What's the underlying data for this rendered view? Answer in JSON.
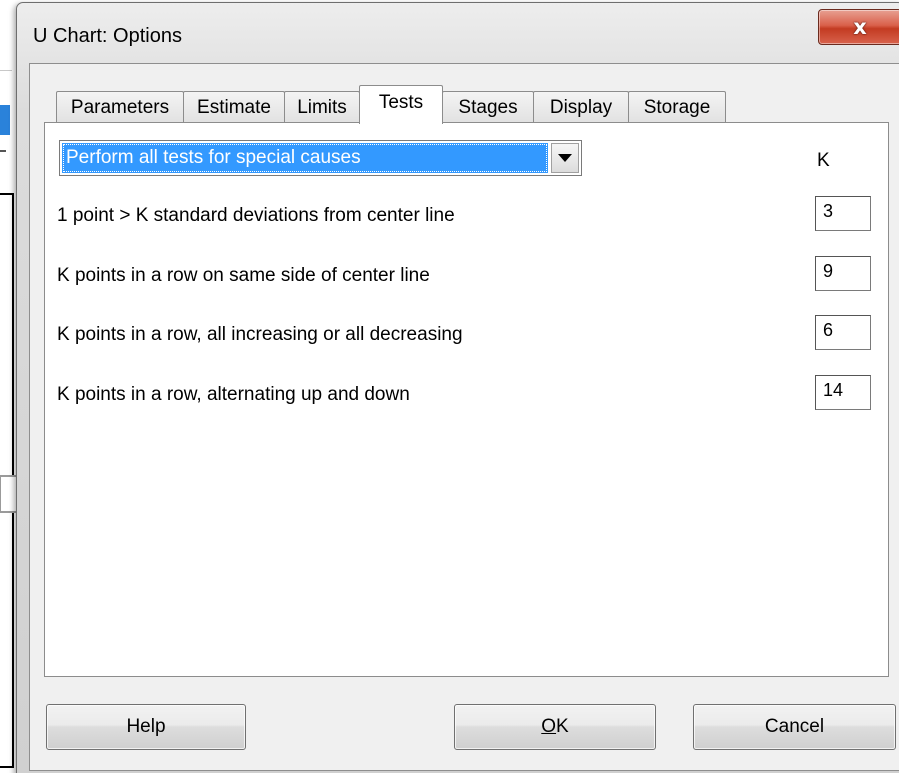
{
  "window": {
    "title": "U Chart: Options",
    "close_glyph": "x"
  },
  "tabs": [
    {
      "label": "Parameters",
      "active": false
    },
    {
      "label": "Estimate",
      "active": false
    },
    {
      "label": "Limits",
      "active": false
    },
    {
      "label": "Tests",
      "active": true
    },
    {
      "label": "Stages",
      "active": false
    },
    {
      "label": "Display",
      "active": false
    },
    {
      "label": "Storage",
      "active": false
    }
  ],
  "tests": {
    "dropdown_value": "Perform all tests for special causes",
    "k_header": "K",
    "rows": [
      {
        "label": "1 point > K standard deviations from center line",
        "k": "3"
      },
      {
        "label": "K points in a row on same side of center line",
        "k": "9"
      },
      {
        "label": "K points in a row, all increasing or all decreasing",
        "k": "6"
      },
      {
        "label": "K points in a row, alternating up and down",
        "k": "14"
      }
    ]
  },
  "buttons": {
    "help": "Help",
    "ok_mnemonic": "O",
    "ok_rest": "K",
    "cancel": "Cancel"
  },
  "colors": {
    "selection": "#3399ff",
    "close_button": "#c33b22",
    "background_accent": "#2a82da"
  }
}
